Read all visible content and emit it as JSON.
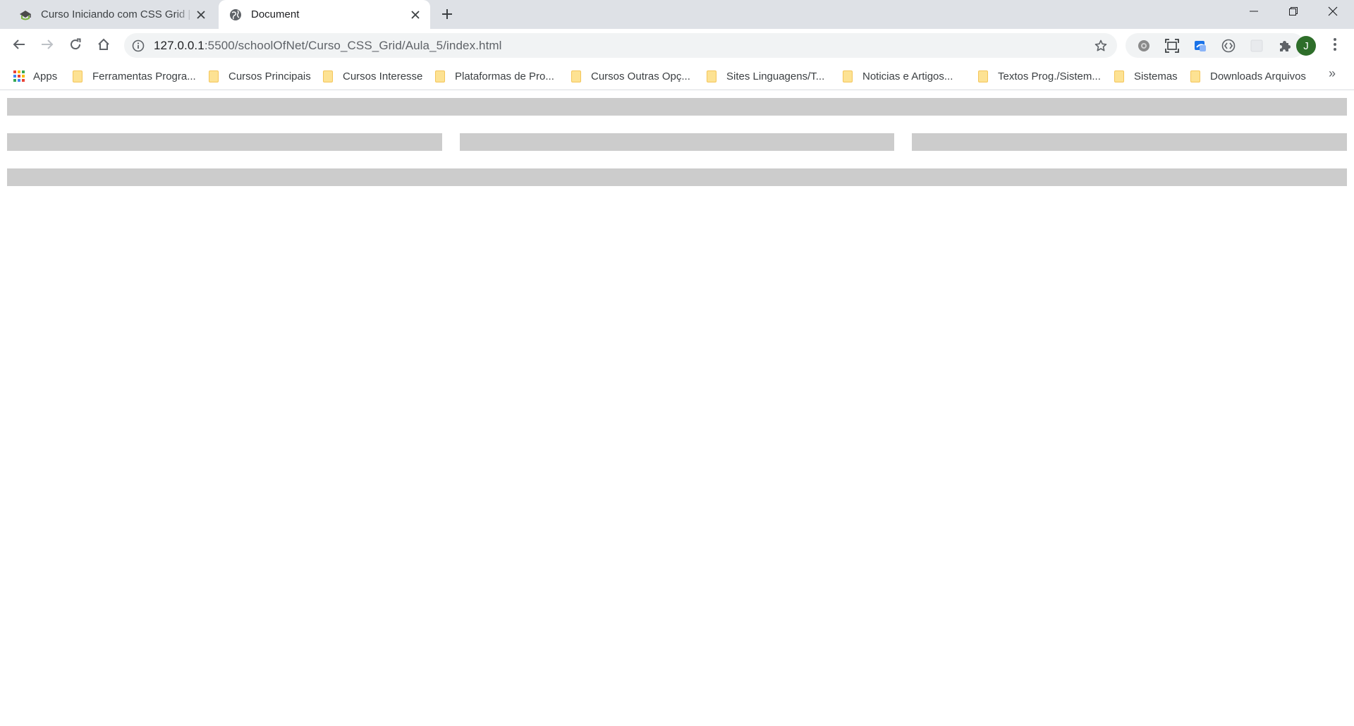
{
  "browser": {
    "tabs": [
      {
        "title": "Curso Iniciando com CSS Grid | School of Net",
        "active": false,
        "favicon": "graduation-cap-icon"
      },
      {
        "title": "Document",
        "active": true,
        "favicon": "globe-icon"
      }
    ],
    "new_tab_icon": "plus-icon",
    "window_controls": [
      "minimize-icon",
      "restore-icon",
      "close-icon"
    ],
    "url": {
      "host": "127.0.0.1",
      "rest": ":5500/schoolOfNet/Curso_CSS_Grid/Aula_5/index.html"
    },
    "profile_initial": "J",
    "bookmarks": [
      {
        "label": "Apps",
        "icon": "apps-grid-icon"
      },
      {
        "label": "Ferramentas Progra...",
        "icon": "folder-icon"
      },
      {
        "label": "Cursos Principais",
        "icon": "folder-icon"
      },
      {
        "label": "Cursos Interesse",
        "icon": "folder-icon"
      },
      {
        "label": "Plataformas de Pro...",
        "icon": "folder-icon"
      },
      {
        "label": "Cursos Outras Opç...",
        "icon": "folder-icon"
      },
      {
        "label": "Sites Linguagens/T...",
        "icon": "folder-icon"
      },
      {
        "label": "Noticias e Artigos...",
        "icon": "folder-icon"
      },
      {
        "label": "Textos Prog./Sistem...",
        "icon": "folder-icon"
      },
      {
        "label": "Sistemas",
        "icon": "folder-icon"
      },
      {
        "label": "Downloads Arquivos",
        "icon": "folder-icon"
      }
    ],
    "bookmarks_overflow": "»"
  },
  "page": {
    "grid_item_color": "#cccccc",
    "items": [
      "header",
      "col-1",
      "col-2",
      "col-3",
      "footer"
    ]
  }
}
